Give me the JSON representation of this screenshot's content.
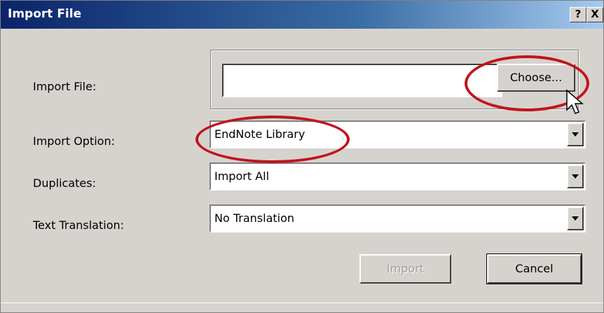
{
  "window": {
    "title": "Import File",
    "help_label": "?",
    "close_label": "X"
  },
  "fields": {
    "import_file": {
      "label": "Import File:",
      "value": "",
      "choose_label": "Choose..."
    },
    "import_option": {
      "label": "Import Option:",
      "value": "EndNote Library"
    },
    "duplicates": {
      "label": "Duplicates:",
      "value": "Import All"
    },
    "text_translation": {
      "label": "Text Translation:",
      "value": "No Translation"
    }
  },
  "buttons": {
    "import_label": "Import",
    "cancel_label": "Cancel"
  },
  "annotations": {
    "highlight_color": "#c0141e"
  }
}
